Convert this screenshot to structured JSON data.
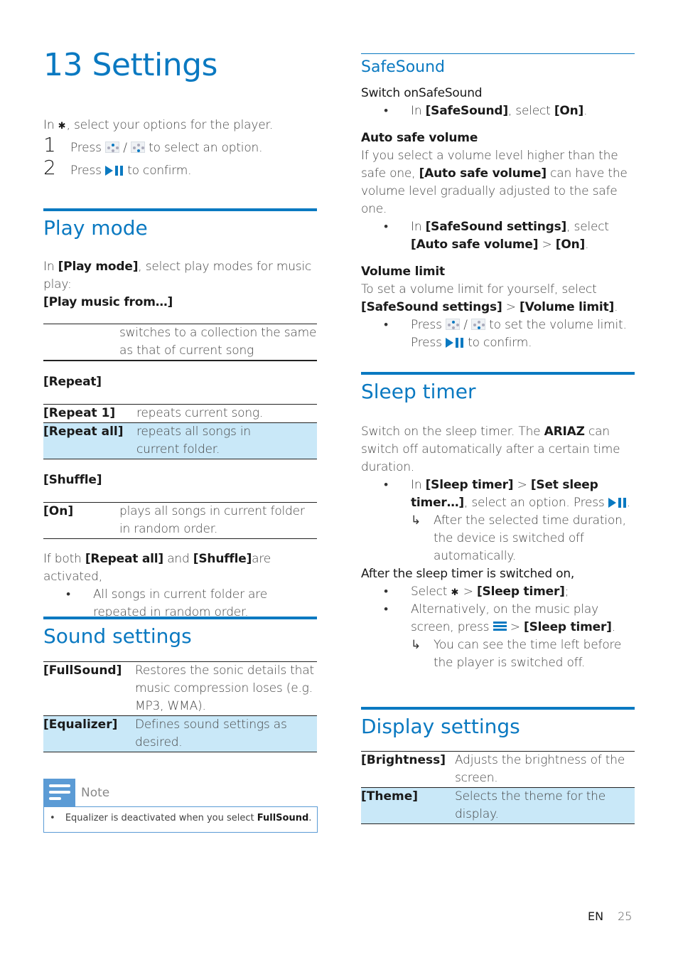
{
  "page": {
    "title": "13 Settings",
    "footer_lang": "EN",
    "footer_page": "25",
    "accent_color": "#0a79c1",
    "highlight_color": "#c9e8f8"
  },
  "intro": {
    "line_pre": "In",
    "line_post": ", select your options for the player.",
    "steps": [
      {
        "num": "1",
        "pre": "Press",
        "mid": "/",
        "post": "to select an option."
      },
      {
        "num": "2",
        "pre": "Press",
        "post": "to confirm."
      }
    ]
  },
  "play_mode": {
    "heading": "Play mode",
    "intro_pre": "In",
    "intro_key": "[Play mode]",
    "intro_post": ", select play modes for music play:",
    "sub1": "[Play music from…]",
    "table1": [
      {
        "key": "",
        "desc": "switches to a collection the same as that of current song"
      }
    ],
    "sub2": "[Repeat]",
    "table2": [
      {
        "key": "[Repeat 1]",
        "desc": "repeats current song."
      },
      {
        "key": "[Repeat all]",
        "desc": "repeats all songs in current folder."
      }
    ],
    "sub3": "[Shuffle]",
    "table3": [
      {
        "key": "[On]",
        "desc": "plays all songs in current folder in random order."
      }
    ],
    "both_pre": "If both",
    "both_k1": "[Repeat all]",
    "both_mid": "and",
    "both_k2": "[Shuffle]",
    "both_post": "are activated,",
    "both_bullet": "All songs in current folder are repeated in random order."
  },
  "sound_settings": {
    "heading": "Sound settings",
    "table": [
      {
        "key": "[FullSound]",
        "desc": "Restores the sonic details that music compression loses (e.g. MP3, WMA)."
      },
      {
        "key": "[Equalizer]",
        "desc": "Defines sound settings as desired."
      }
    ],
    "note_label": "Note",
    "note_text_pre": "Equalizer is deactivated when you select",
    "note_text_key": "FullSound",
    "note_text_post": "."
  },
  "safesound": {
    "heading": "SafeSound",
    "switch_on": "Switch onSafeSound",
    "b1_pre": "In",
    "b1_k1": "[SafeSound]",
    "b1_mid": ", select",
    "b1_k2": "[On]",
    "b1_post": ".",
    "auto_heading": "Auto safe volume",
    "auto_pre": "If you select a volume level higher than the safe one,",
    "auto_key": "[Auto safe volume]",
    "auto_post": "can have the volume level gradually adjusted to the safe one.",
    "b2_pre": "In",
    "b2_k1": "[SafeSound settings]",
    "b2_mid": ", select",
    "b2_k2": "[Auto safe volume]",
    "b2_gt": ">",
    "b2_k3": "[On]",
    "b2_post": ".",
    "limit_heading": "Volume limit",
    "limit_pre": "To set a volume limit for yourself, select",
    "limit_k1": "[SafeSound settings]",
    "limit_gt": ">",
    "limit_k2": "[Volume limit]",
    "limit_post": ".",
    "b3_pre": "Press",
    "b3_mid": "/",
    "b3_post": "to set the volume limit.",
    "b3_line2_pre": "Press",
    "b3_line2_post": "to confirm."
  },
  "sleep_timer": {
    "heading": "Sleep timer",
    "intro_pre": "Switch on the sleep timer. The",
    "intro_key": "ARIAZ",
    "intro_post": "can switch off automatically after a certain time duration.",
    "b1_pre": "In",
    "b1_k1": "[Sleep timer]",
    "b1_gt": ">",
    "b1_k2": "[Set sleep timer…]",
    "b1_post": ", select an option. Press",
    "b1_end": ".",
    "b1_result": "After the selected time duration, the device is switched off automatically.",
    "after_heading": "After the sleep timer is switched on,",
    "b2_pre": "Select",
    "b2_gt": ">",
    "b2_k": "[Sleep timer]",
    "b2_post": ";",
    "b3_pre": "Alternatively, on the music play screen, press",
    "b3_gt": ">",
    "b3_k": "[Sleep timer]",
    "b3_post": ".",
    "b3_result": "You can see the time left before the player is switched off."
  },
  "display_settings": {
    "heading": "Display settings",
    "table": [
      {
        "key": "[Brightness]",
        "desc": "Adjusts the brightness of the screen."
      },
      {
        "key": "[Theme]",
        "desc": "Selects the theme for the display."
      }
    ]
  }
}
